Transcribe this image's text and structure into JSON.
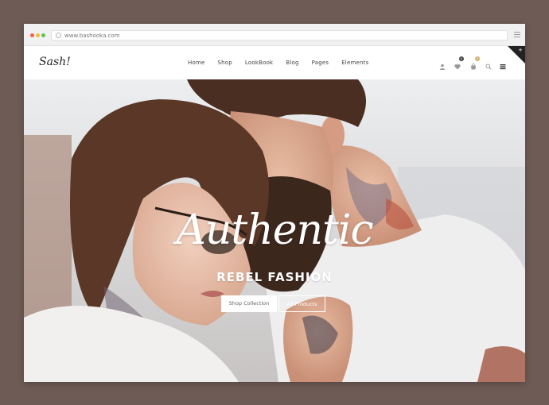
{
  "browser": {
    "url": "www.bashooka.com"
  },
  "header": {
    "logo": "Sash!",
    "menu": [
      {
        "label": "Home"
      },
      {
        "label": "Shop"
      },
      {
        "label": "LookBook"
      },
      {
        "label": "Blog"
      },
      {
        "label": "Pages"
      },
      {
        "label": "Elements"
      }
    ],
    "icons": [
      "user-icon",
      "heart-icon",
      "cart-icon",
      "search-icon",
      "menu-grid-icon"
    ],
    "wishlist_badge": "0",
    "cart_badge": "0",
    "corner_symbol": "+"
  },
  "hero": {
    "headline": "Authentic",
    "subheadline": "REBEL FASHION",
    "primary_button": "Shop Collection",
    "secondary_button": "All Products"
  },
  "colors": {
    "page_background": "#6e5b55",
    "accent": "#d6b16e",
    "dark": "#222222"
  }
}
